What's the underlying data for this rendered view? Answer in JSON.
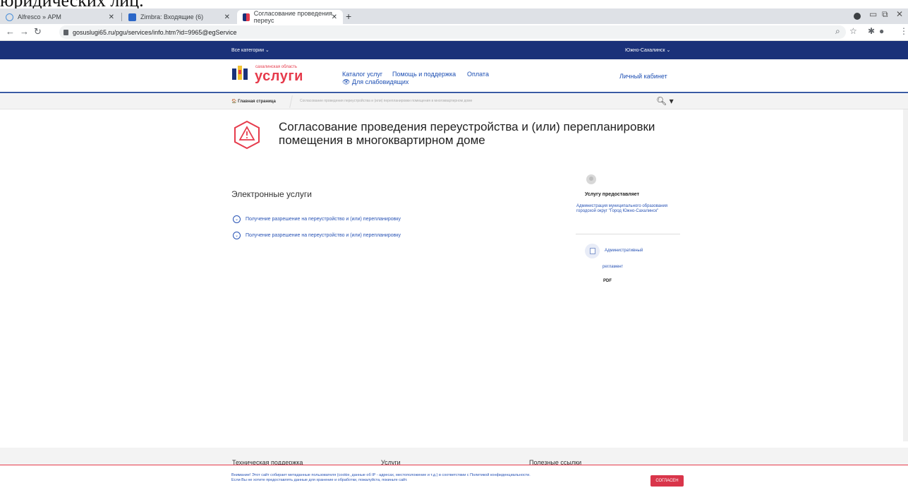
{
  "doc_bleed_text": "юридических лиц.",
  "browser": {
    "tabs": [
      {
        "label": "Alfresco » АРМ"
      },
      {
        "label": "Zimbra: Входящие (6)"
      },
      {
        "label": "Согласование проведения переус"
      }
    ],
    "new_tab": "+",
    "url": "gosuslugi65.ru/pgu/services/info.htm?id=9965@egService"
  },
  "topbar": {
    "categories": "Все категории  ⌄",
    "city": "Южно-Сахалинск  ⌄"
  },
  "header": {
    "logo_small": "сахалинская область",
    "logo_big": "услуги",
    "nav": [
      "Каталог услуг",
      "Помощь и поддержка",
      "Оплата"
    ],
    "accessibility": "👁 Для слабовидящих",
    "cabinet": "Личный кабинет"
  },
  "breadcrumb": {
    "home": "🏠 Главная страница",
    "current": "Согласование проведения переустройства и (или) перепланировки помещения в многоквартирном доме"
  },
  "page": {
    "title": "Согласование проведения переустройства и (или) перепланировки помещения в многоквартирном доме",
    "section_title": "Электронные услуги",
    "services": [
      "Получение разрешение на переустройство и (или) перепланировку",
      "Получение разрешение на переустройство и (или) перепланировку"
    ]
  },
  "side": {
    "provider_head": "Услугу предоставляет",
    "provider_org": "Администрация муниципального образования городской округ \"Город Южно-Сахалинск\"",
    "doc_label_1": "Административный",
    "doc_label_2": "регламент",
    "doc_format": "PDF"
  },
  "footer": {
    "cols": [
      "Техническая поддержка",
      "Услуги",
      "Полезные ссылки"
    ]
  },
  "cookie": {
    "line1": "Внимание! Этот сайт собирает метаданные пользователя (cookie, данные об IP - адресах, местоположение и т.д.) в соответствии с Политикой конфиденциальности.",
    "line2": "Если Вы не хотите предоставлять данные для хранение и обработки, пожалуйста, покиньте сайт.",
    "button": "СОГЛАСЕН"
  },
  "colors": {
    "topbar": "#1a3179",
    "brand_red": "#e63b4c",
    "link_blue": "#2853b5"
  }
}
